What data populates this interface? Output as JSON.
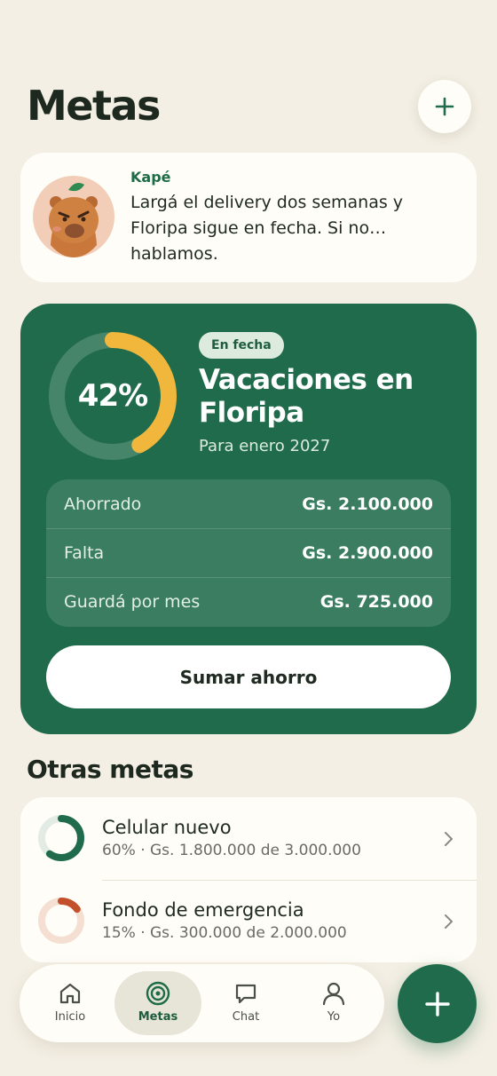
{
  "header": {
    "title": "Metas"
  },
  "kape": {
    "name": "Kapé",
    "message": "Largá el delivery dos semanas y Floripa sigue en fecha. Si no… hablamos."
  },
  "featured_goal": {
    "progress": 0.42,
    "progress_label": "42%",
    "badge": "En fecha",
    "title": "Vacaciones en Floripa",
    "subtitle": "Para enero 2027",
    "stats": [
      {
        "label": "Ahorrado",
        "value": "Gs. 2.100.000"
      },
      {
        "label": "Falta",
        "value": "Gs. 2.900.000"
      },
      {
        "label": "Guardá por mes",
        "value": "Gs. 725.000"
      }
    ],
    "action_label": "Sumar ahorro"
  },
  "other_goals": {
    "title": "Otras metas",
    "items": [
      {
        "title": "Celular nuevo",
        "detail": "60% · Gs. 1.800.000 de 3.000.000",
        "progress": 0.6,
        "color": "#1F6B4B",
        "track": "#E3ECE4"
      },
      {
        "title": "Fondo de emergencia",
        "detail": "15% · Gs. 300.000 de 2.000.000",
        "progress": 0.15,
        "color": "#C2502A",
        "track": "#F5DFD2"
      }
    ]
  },
  "nav": {
    "items": [
      {
        "label": "Inicio",
        "icon": "home-icon"
      },
      {
        "label": "Metas",
        "icon": "target-icon",
        "active": true
      },
      {
        "label": "Chat",
        "icon": "chat-icon"
      },
      {
        "label": "Yo",
        "icon": "user-icon"
      }
    ]
  },
  "colors": {
    "accent": "#1F6B4B",
    "ring_progress": "#F1B73C",
    "background": "#F4EFE4"
  }
}
